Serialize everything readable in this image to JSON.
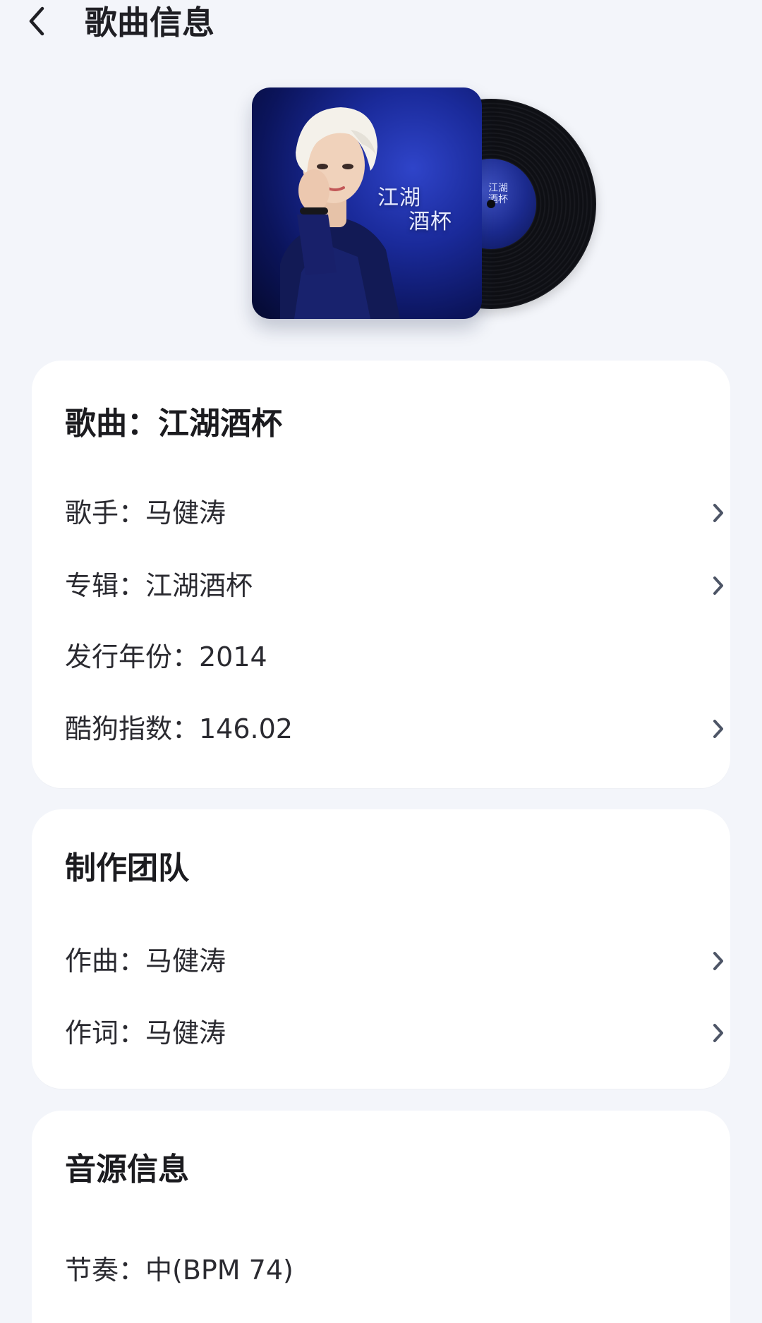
{
  "header": {
    "title": "歌曲信息",
    "back_icon": "chevron-left-icon"
  },
  "cover": {
    "art_text": "江湖\n酒杯",
    "art_text_line1": "江湖",
    "art_text_line2": "酒杯"
  },
  "song_card": {
    "title": "歌曲：江湖酒杯",
    "rows": [
      {
        "label": "歌手：马健涛",
        "has_chevron": true
      },
      {
        "label": "专辑：江湖酒杯",
        "has_chevron": true
      },
      {
        "label": "发行年份：2014",
        "has_chevron": false
      },
      {
        "label": "酷狗指数：146.02",
        "has_chevron": true
      }
    ]
  },
  "team_card": {
    "title": "制作团队",
    "rows": [
      {
        "label": "作曲：马健涛",
        "has_chevron": true
      },
      {
        "label": "作词：马健涛",
        "has_chevron": true
      }
    ]
  },
  "source_card": {
    "title": "音源信息",
    "rows": [
      {
        "label": "节奏：中(BPM 74)",
        "has_chevron": false
      }
    ]
  },
  "colors": {
    "background": "#f3f5fa",
    "card": "#ffffff",
    "text_primary": "#1b1b1f",
    "chevron": "#4d5566"
  }
}
